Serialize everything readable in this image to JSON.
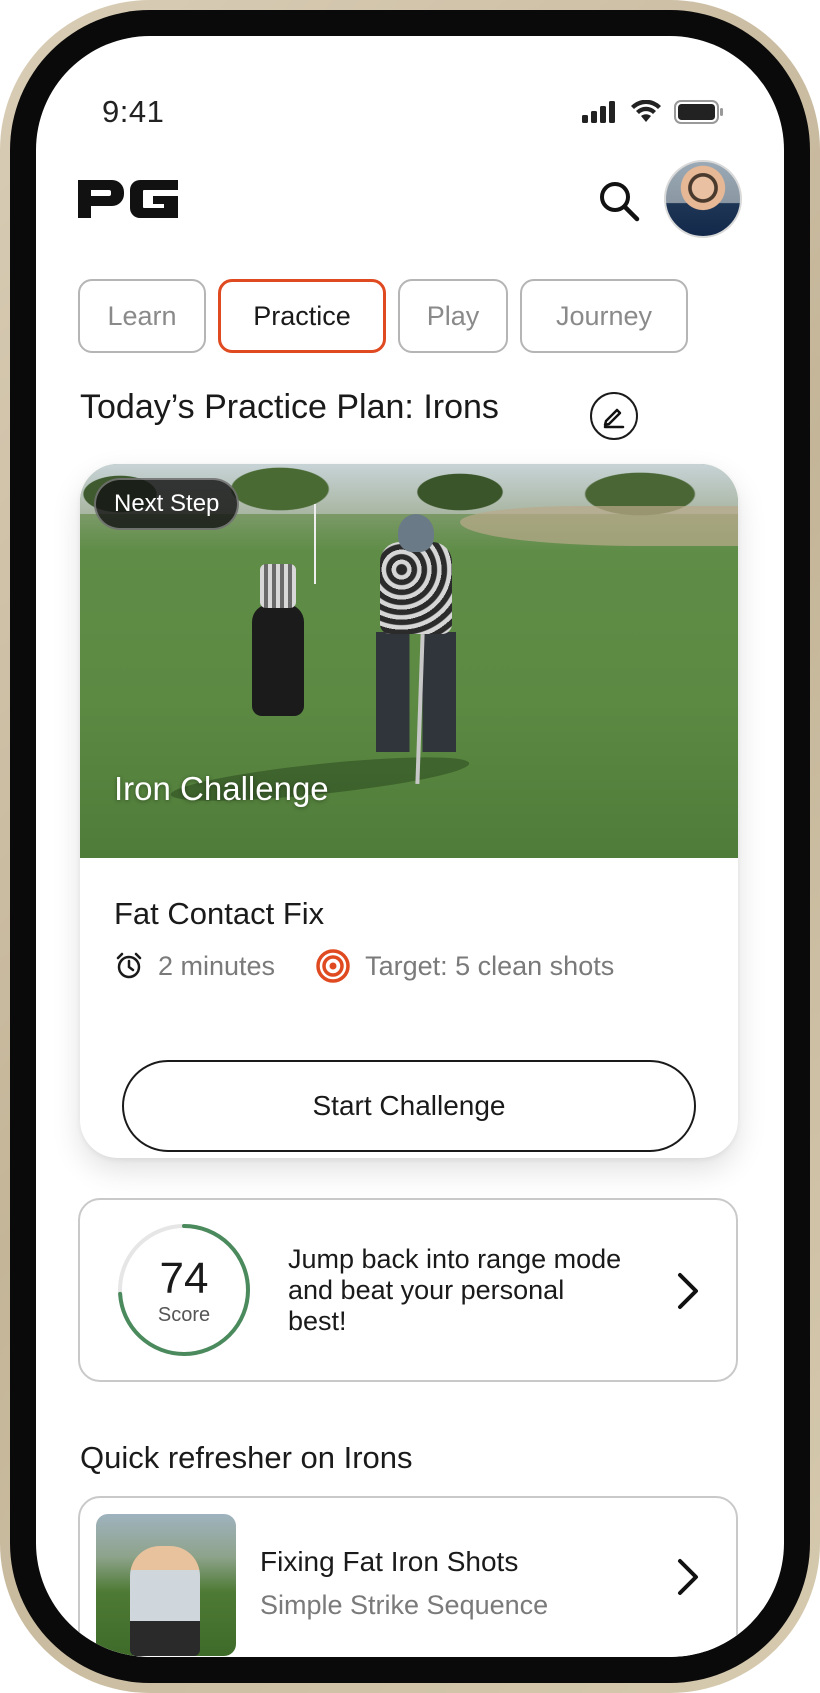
{
  "status_bar": {
    "time": "9:41"
  },
  "header": {
    "logo_text": "PG",
    "search_icon": "search-icon",
    "avatar_icon": "avatar"
  },
  "tabs": [
    {
      "label": "Learn",
      "active": false
    },
    {
      "label": "Practice",
      "active": true
    },
    {
      "label": "Play",
      "active": false
    },
    {
      "label": "Journey",
      "active": false
    }
  ],
  "practice_plan": {
    "title": "Today’s Practice Plan: Irons",
    "edit_icon": "pencil-icon"
  },
  "challenge": {
    "badge": "Next Step",
    "hero_title": "Iron Challenge",
    "name": "Fat Contact Fix",
    "duration": "2 minutes",
    "target": "Target: 5 clean shots",
    "button_label": "Start Challenge"
  },
  "score_card": {
    "score": "74",
    "score_label": "Score",
    "progress": 0.74,
    "message": "Jump back into range mode and beat your personal best!"
  },
  "refresher": {
    "title": "Quick refresher on Irons",
    "lesson_title": "Fixing Fat Iron Shots",
    "lesson_subtitle": "Simple Strike Sequence"
  },
  "colors": {
    "accent": "#e04a21",
    "score_ring": "#4a8a5c",
    "text_primary": "#1a1a1a",
    "text_secondary": "#7a7a7a"
  }
}
